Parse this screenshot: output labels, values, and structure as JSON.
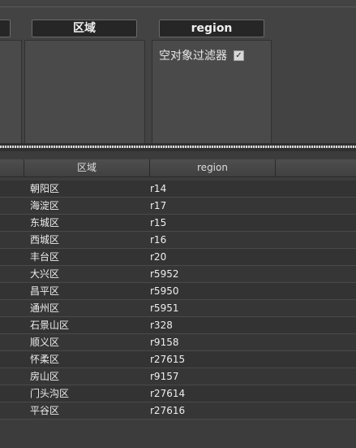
{
  "filters": {
    "columns": [
      {
        "label": "",
        "options": []
      },
      {
        "label": "区域",
        "options": []
      },
      {
        "label": "region",
        "options": [
          {
            "label": "空对象过滤器",
            "checked": true
          }
        ]
      }
    ]
  },
  "table": {
    "headers": [
      "",
      "区域",
      "region",
      ""
    ],
    "rows": [
      {
        "district": "朝阳区",
        "region": "r14"
      },
      {
        "district": "海淀区",
        "region": "r17"
      },
      {
        "district": "东城区",
        "region": "r15"
      },
      {
        "district": "西城区",
        "region": "r16"
      },
      {
        "district": "丰台区",
        "region": "r20"
      },
      {
        "district": "大兴区",
        "region": "r5952"
      },
      {
        "district": "昌平区",
        "region": "r5950"
      },
      {
        "district": "通州区",
        "region": "r5951"
      },
      {
        "district": "石景山区",
        "region": "r328"
      },
      {
        "district": "顺义区",
        "region": "r9158"
      },
      {
        "district": "怀柔区",
        "region": "r27615"
      },
      {
        "district": "房山区",
        "region": "r9157"
      },
      {
        "district": "门头沟区",
        "region": "r27614"
      },
      {
        "district": "平谷区",
        "region": "r27616"
      }
    ]
  },
  "theme": {
    "background": "#3c3c3c",
    "header_background": "#262626",
    "text": "#eeeeee"
  }
}
